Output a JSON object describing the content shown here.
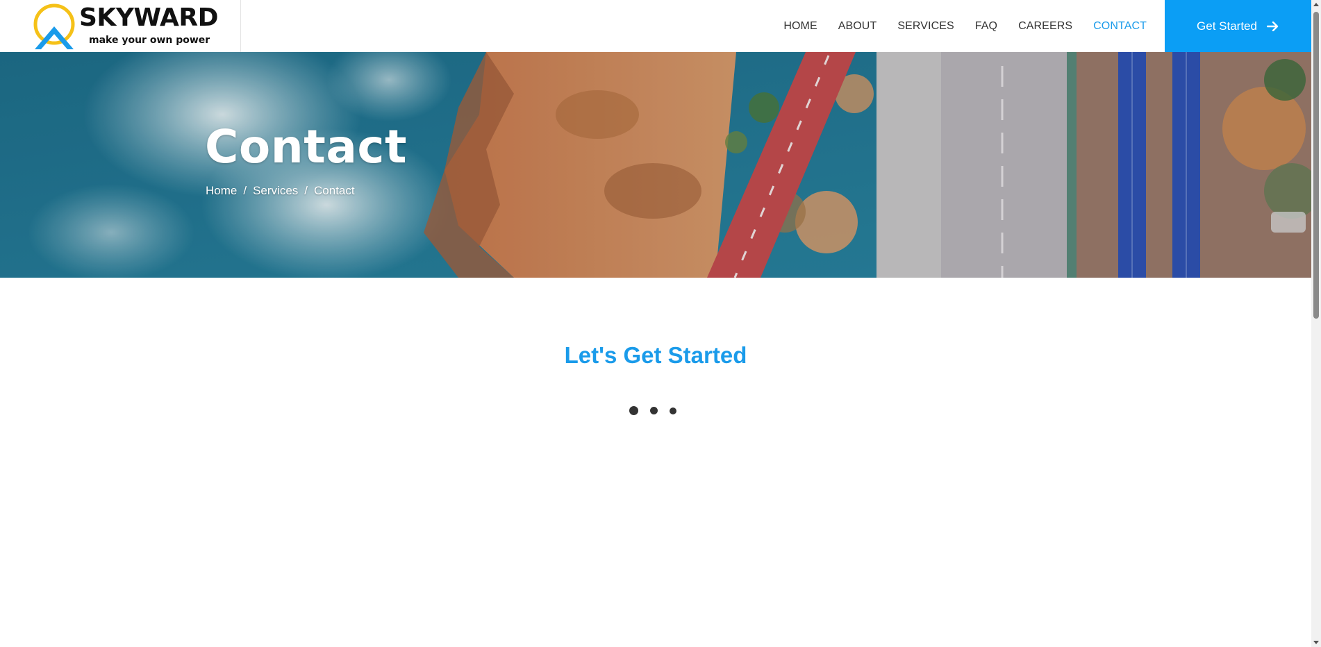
{
  "brand": {
    "name": "SKYWARD",
    "tagline": "make your own power",
    "colors": {
      "sun": "#f5c118",
      "mountain": "#1a9bea"
    }
  },
  "nav": {
    "items": [
      {
        "label": "HOME"
      },
      {
        "label": "ABOUT"
      },
      {
        "label": "SERVICES"
      },
      {
        "label": "FAQ"
      },
      {
        "label": "CAREERS"
      },
      {
        "label": "CONTACT"
      }
    ],
    "active": "CONTACT",
    "active_color": "#1a9bea",
    "cta_label": "Get Started",
    "cta_icon": "arrow-right-icon",
    "cta_color": "#0b9ef5"
  },
  "hero": {
    "title": "Contact",
    "breadcrumb": [
      "Home",
      "Services",
      "Contact"
    ],
    "breadcrumb_separator": "/"
  },
  "main": {
    "heading": "Let's Get Started",
    "heading_color": "#1a9bea",
    "loader": "loading-dots-icon"
  }
}
